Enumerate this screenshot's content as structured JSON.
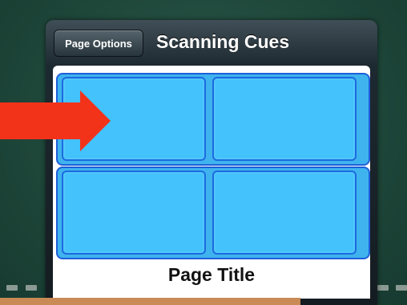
{
  "dialog": {
    "title": "Scanning Cues",
    "back_button_label": "Page Options"
  },
  "panel": {
    "page_title": "Page Title",
    "cells": [
      {
        "row": 1,
        "col": 1
      },
      {
        "row": 1,
        "col": 2
      },
      {
        "row": 2,
        "col": 1
      },
      {
        "row": 2,
        "col": 2
      }
    ]
  },
  "colors": {
    "cell_fill": "#43c2fb",
    "cell_border": "#1c6be0",
    "arrow": "#f2331a",
    "background": "#1f4a3d"
  },
  "icons": {
    "pointer": "right-arrow-icon"
  }
}
